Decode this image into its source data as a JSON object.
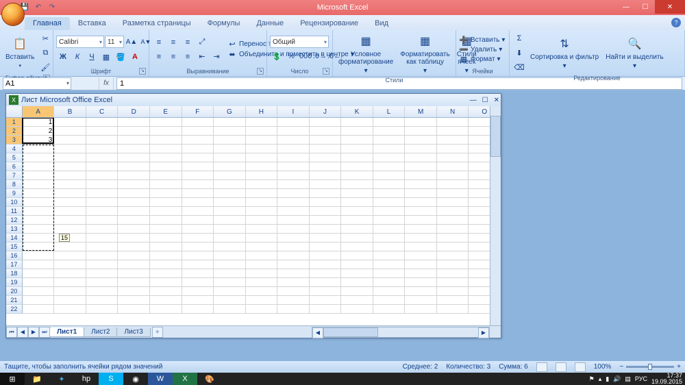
{
  "app": {
    "title": "Microsoft Excel"
  },
  "qat": {
    "save": "💾",
    "undo": "↶",
    "redo": "↷"
  },
  "tabs": [
    "Главная",
    "Вставка",
    "Разметка страницы",
    "Формулы",
    "Данные",
    "Рецензирование",
    "Вид"
  ],
  "active_tab": 0,
  "ribbon": {
    "clipboard": {
      "paste": "Вставить",
      "label": "Буфер обмена"
    },
    "font": {
      "name": "Calibri",
      "size": "11",
      "label": "Шрифт"
    },
    "align": {
      "wrap": "Перенос текста",
      "merge": "Объединить и поместить в центре",
      "label": "Выравнивание"
    },
    "number": {
      "format": "Общий",
      "label": "Число"
    },
    "styles": {
      "cond": "Условное форматирование",
      "table": "Форматировать как таблицу",
      "cell": "Стили ячеек",
      "label": "Стили"
    },
    "cells": {
      "insert": "Вставить",
      "delete": "Удалить",
      "format": "Формат",
      "label": "Ячейки"
    },
    "editing": {
      "sort": "Сортировка и фильтр",
      "find": "Найти и выделить",
      "label": "Редактирование"
    }
  },
  "namebox": "A1",
  "formula": "1",
  "docwin": {
    "title": "Лист Microsoft Office Excel"
  },
  "columns": [
    "A",
    "B",
    "C",
    "D",
    "E",
    "F",
    "G",
    "H",
    "I",
    "J",
    "K",
    "L",
    "M",
    "N",
    "O"
  ],
  "rows": 22,
  "cells": {
    "A1": "1",
    "A2": "2",
    "A3": "3"
  },
  "selection": {
    "col": "A",
    "rows": [
      1,
      3
    ]
  },
  "fill_drag_to_row": 15,
  "fill_hint": "15",
  "sheets": [
    "Лист1",
    "Лист2",
    "Лист3"
  ],
  "active_sheet": 0,
  "status": {
    "mode": "Тащите, чтобы заполнить ячейки рядом значений",
    "avg_label": "Среднее:",
    "avg": "2",
    "count_label": "Количество:",
    "count": "3",
    "sum_label": "Сумма:",
    "sum": "6",
    "zoom": "100%"
  },
  "tray": {
    "lang": "РУС",
    "time": "17:37",
    "date": "19.09.2015"
  }
}
